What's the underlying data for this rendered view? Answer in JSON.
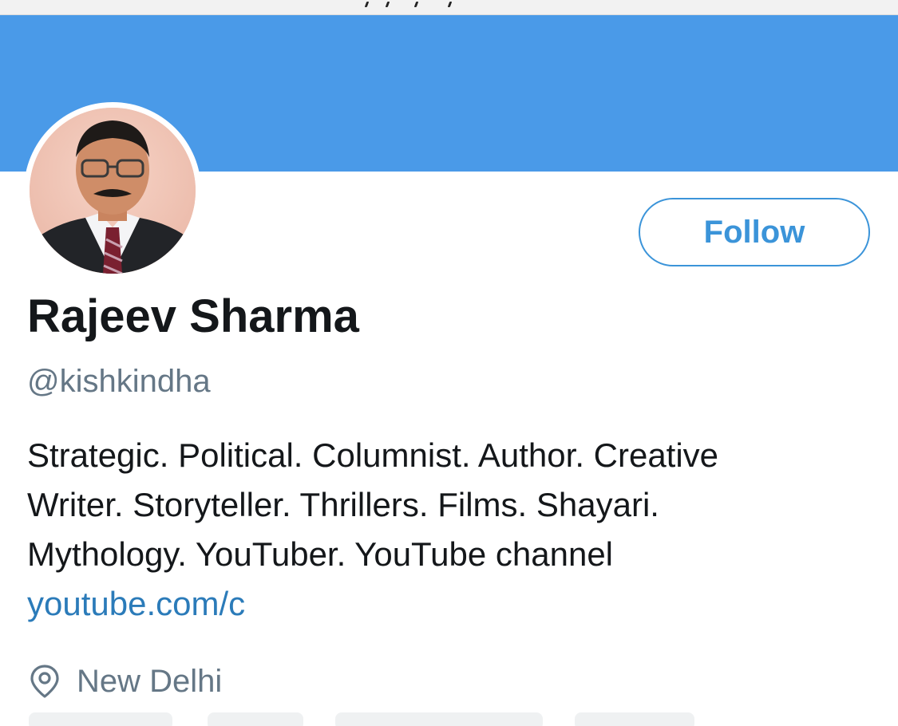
{
  "colors": {
    "banner": "#4a9ae8",
    "accent": "#3b94d9",
    "link": "#2b7bb9",
    "name": "#14171a",
    "secondary": "#657786"
  },
  "profile": {
    "name": "Rajeev Sharma",
    "handle": "@kishkindha",
    "avatar_icon": "profile-photo",
    "follow_label": "Follow",
    "bio_lines": [
      "Strategic. Political. Columnist. Author. Creative",
      "Writer. Storyteller. Thrillers. Films. Shayari.",
      "Mythology. YouTuber. YouTube channel"
    ],
    "bio_link": "youtube.com/c",
    "location_icon": "map-pin-icon",
    "location": "New Delhi"
  }
}
